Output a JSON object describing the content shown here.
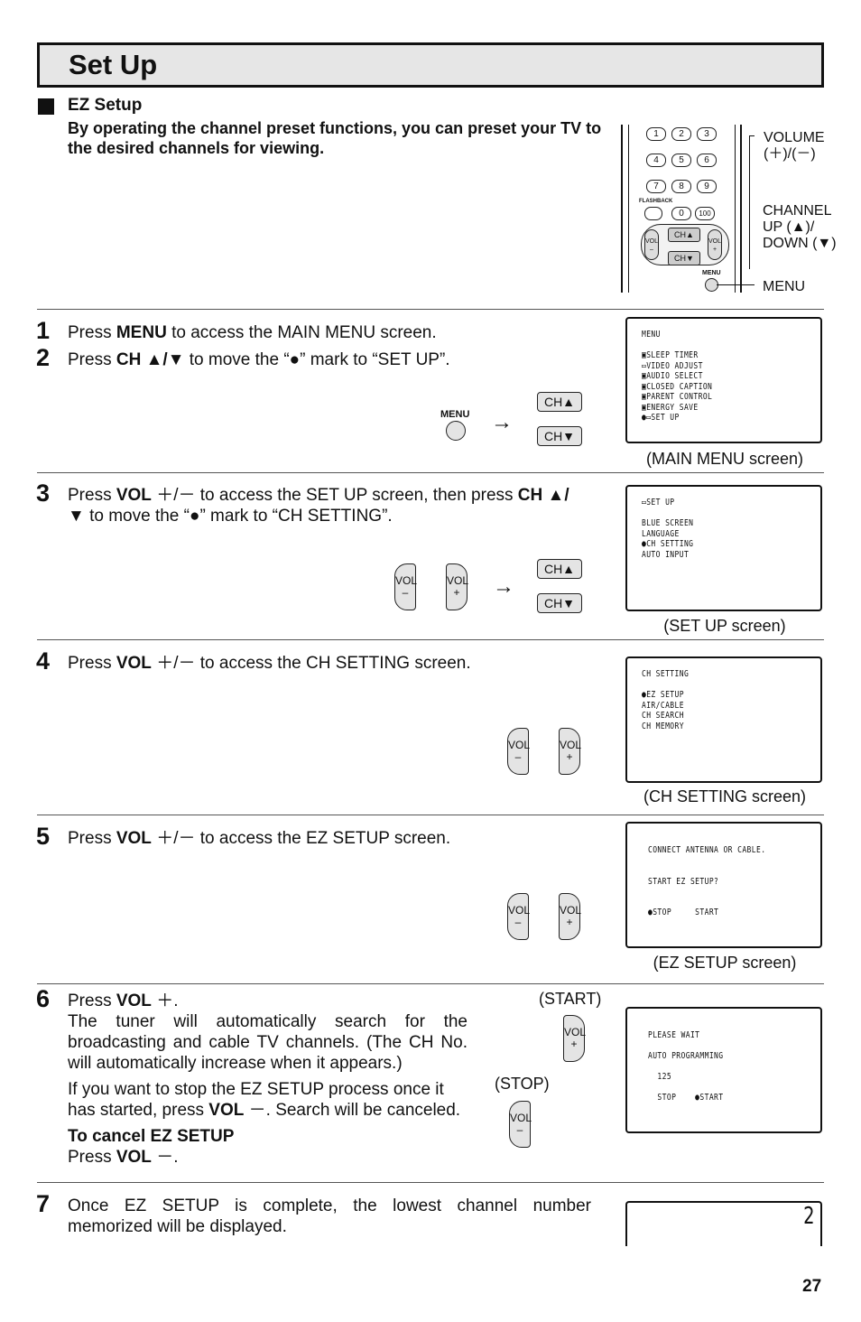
{
  "title": "Set Up",
  "section": {
    "heading": "EZ Setup",
    "intro": "By operating the channel preset functions, you can preset your TV to the desired channels for viewing."
  },
  "remote": {
    "keys": [
      "1",
      "2",
      "3",
      "4",
      "5",
      "6",
      "7",
      "8",
      "9",
      "0",
      "100"
    ],
    "flashback": "FLASHBACK",
    "ch_up": "CH▲",
    "ch_down": "CH▼",
    "vol_minus": "VOL –",
    "vol_plus": "VOL +",
    "menu": "MENU",
    "labels": {
      "volume": "VOLUME",
      "volume_sub": "(＋)/(－)",
      "channel": "CHANNEL",
      "channel_up": "UP (▲)/",
      "channel_down": "DOWN (▼)",
      "menu": "MENU"
    }
  },
  "buttons": {
    "menu": "MENU",
    "ch_up": "CH▲",
    "ch_down": "CH▼",
    "vol": "VOL",
    "minus": "–",
    "plus": "+",
    "arrow": "→",
    "start": "(START)",
    "stop": "(STOP)"
  },
  "steps": [
    {
      "n": "1",
      "pre": "Press ",
      "b1": "MENU",
      "post": " to access the MAIN MENU screen."
    },
    {
      "n": "2",
      "pre": "Press ",
      "b1": "CH ▲/▼",
      "post": " to move the “●” mark to “SET UP”."
    },
    {
      "n": "3",
      "pre": "Press ",
      "b1": "VOL",
      "mid": " ＋/－ to access the SET UP screen, then press ",
      "b2": "CH ▲/▼",
      "post": " to move the “●” mark to “CH SETTING”."
    },
    {
      "n": "4",
      "pre": "Press ",
      "b1": "VOL",
      "post": " ＋/－ to access the CH SETTING screen."
    },
    {
      "n": "5",
      "pre": "Press ",
      "b1": "VOL",
      "post": " ＋/－ to access the EZ SETUP screen."
    },
    {
      "n": "6",
      "pre": "Press ",
      "b1": "VOL",
      "post": " ＋.",
      "p2": "The tuner will automatically search for the broadcasting and cable TV channels. (The CH No. will automatically increase when it appears.)",
      "p3pre": "If you want to stop the EZ SETUP process once it has started, press ",
      "p3b": "VOL",
      "p3post": " －. Search will be canceled.",
      "cancel_h": "To cancel EZ SETUP",
      "cancel_pre": "Press ",
      "cancel_b": "VOL",
      "cancel_post": " －."
    },
    {
      "n": "7",
      "text": "Once EZ SETUP is complete, the lowest channel number memorized will be displayed."
    }
  ],
  "screens": [
    {
      "lines": [
        "MENU",
        "",
        "▣SLEEP TIMER",
        "▭VIDEO ADJUST",
        "▣AUDIO SELECT",
        "▣CLOSED CAPTION",
        "▣PARENT CONTROL",
        "▣ENERGY SAVE",
        "●▭SET UP"
      ],
      "caption": "(MAIN MENU screen)"
    },
    {
      "lines": [
        "▭SET UP",
        "",
        "BLUE SCREEN",
        "LANGUAGE",
        "●CH SETTING",
        "AUTO INPUT"
      ],
      "caption": "(SET UP screen)"
    },
    {
      "lines": [
        "CH SETTING",
        "",
        "●EZ SETUP",
        "AIR/CABLE",
        "CH SEARCH",
        "CH MEMORY"
      ],
      "caption": "(CH SETTING screen)"
    },
    {
      "lines": [
        "CONNECT ANTENNA OR CABLE.",
        "",
        "",
        "START EZ SETUP?",
        "",
        "",
        "●STOP     START"
      ],
      "caption": "(EZ SETUP screen)"
    },
    {
      "lines": [
        "PLEASE WAIT",
        "",
        "AUTO PROGRAMMING",
        "",
        "  125",
        "",
        "  STOP    ●START"
      ]
    },
    {
      "channel": "2"
    }
  ],
  "page_number": "27"
}
